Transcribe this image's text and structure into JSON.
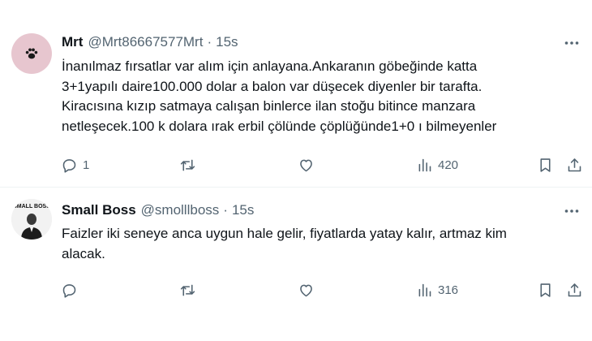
{
  "tweets": [
    {
      "author_name": "Mrt",
      "handle": "@Mrt86667577Mrt",
      "separator": "·",
      "time": "15s",
      "text_lines": [
        "İnanılmaz fırsatlar var alım için anlayana.Ankaranın göbeğinde katta",
        "3+1yapılı daire100.000 dolar a balon var düşecek diyenler bir tarafta.",
        "Kiracısına kızıp satmaya calışan binlerce ilan stoğu bitince manzara",
        "netleşecek.100 k dolara ırak erbil çölünde çöplüğünde1+0 ı bilmeyenler"
      ],
      "reply_count": "1",
      "retweet_count": "",
      "like_count": "",
      "view_count": "420",
      "avatar_icon": "paw-icon",
      "avatar_color": "#e7c6cf"
    },
    {
      "author_name": "Small Boss",
      "handle": "@smolllboss",
      "separator": "·",
      "time": "15s",
      "text_lines": [
        "Faizler iki seneye anca uygun hale gelir, fiyatlarda yatay kalır, artmaz kim",
        "alacak."
      ],
      "reply_count": "",
      "retweet_count": "",
      "like_count": "",
      "view_count": "316",
      "avatar_text": "SMALL BOSS",
      "avatar_color": "#f2f2f2"
    }
  ],
  "colors": {
    "text": "#0f1419",
    "muted": "#536471",
    "divider": "#eff3f4"
  }
}
